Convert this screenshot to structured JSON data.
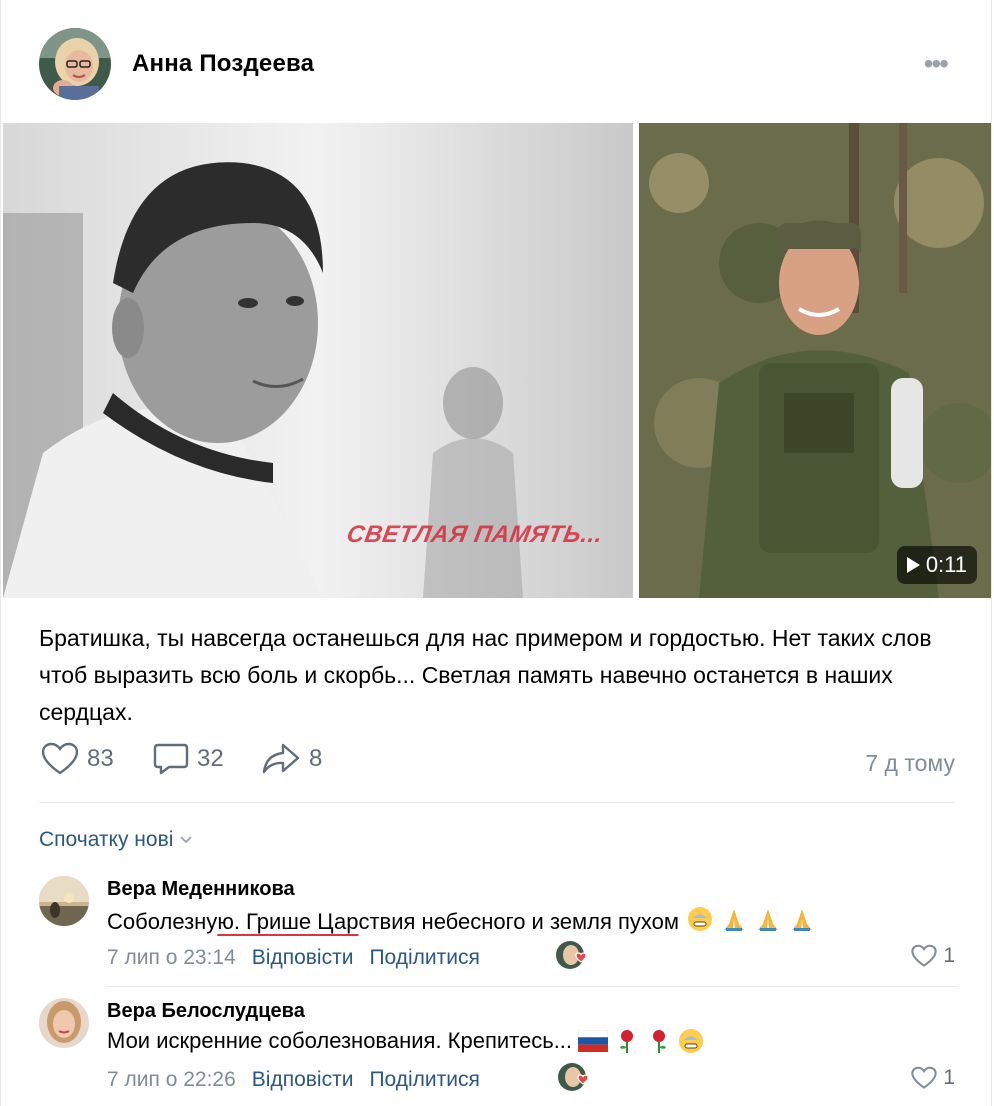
{
  "post": {
    "author": "Анна Поздеева",
    "more_label": "•••",
    "image_caption": "СВЕТЛАЯ ПАМЯТЬ...",
    "video_duration": "0:11",
    "text": "Братишка, ты навсегда останешься для нас примером и гордостью. Нет таких слов чтоб выразить всю боль и скорбь... Светлая память навечно останется в наших сердцах.",
    "likes": "83",
    "comments": "32",
    "shares": "8",
    "time_ago": "7 д тому"
  },
  "comments_section": {
    "sort_label": "Спочатку нові",
    "items": [
      {
        "name": "Вера Меденникова",
        "text_part1": "Соболезну",
        "text_part2": "ю. Грише Цар",
        "text_part3": "ствия небесного и земля пухом",
        "time": "7 лип о 23:14",
        "reply_label": "Відповісти",
        "share_label": "Поділитися",
        "likes": "1"
      },
      {
        "name": "Вера Белослудцева",
        "text": "Мои искренние соболезнования. Крепитесь...",
        "time": "7 лип о 22:26",
        "reply_label": "Відповісти",
        "share_label": "Поділитися",
        "likes": "1"
      }
    ]
  },
  "colors": {
    "link": "#2a5885",
    "secondary": "#818c99",
    "icon": "#626d7a",
    "like_heart": "#e64646"
  }
}
